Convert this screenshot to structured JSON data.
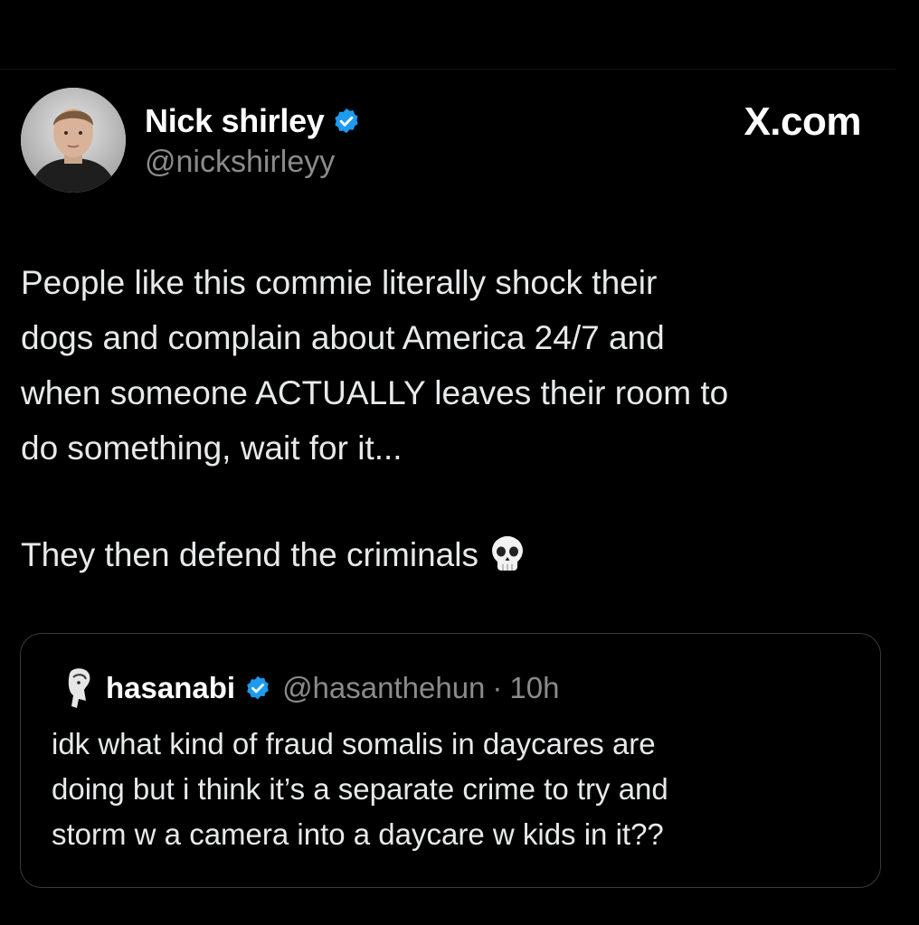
{
  "post": {
    "author": {
      "display_name": "Nick shirley",
      "handle": "@nickshirleyy",
      "verified": true
    },
    "site_label": "X.com",
    "text_main": "People like this commie literally shock their\ndogs and complain about America 24/7 and\nwhen someone ACTUALLY leaves their room to\ndo something, wait for it...",
    "text_followup": "They then defend the criminals",
    "followup_emoji": "skull-icon"
  },
  "quoted_post": {
    "author": {
      "display_name": "hasanabi",
      "handle": "@hasanthehun",
      "verified": true
    },
    "separator": "·",
    "time": "10h",
    "text": "idk what kind of fraud somalis in daycares are\ndoing but i think it’s a separate crime to try and\nstorm w a camera into a daycare w kids in it??"
  },
  "colors": {
    "background": "#000000",
    "verified_badge": "#1d9bf0",
    "primary_text": "#e7e9ea",
    "secondary_text": "#8b8b8b",
    "card_border": "#3a3a3a"
  }
}
